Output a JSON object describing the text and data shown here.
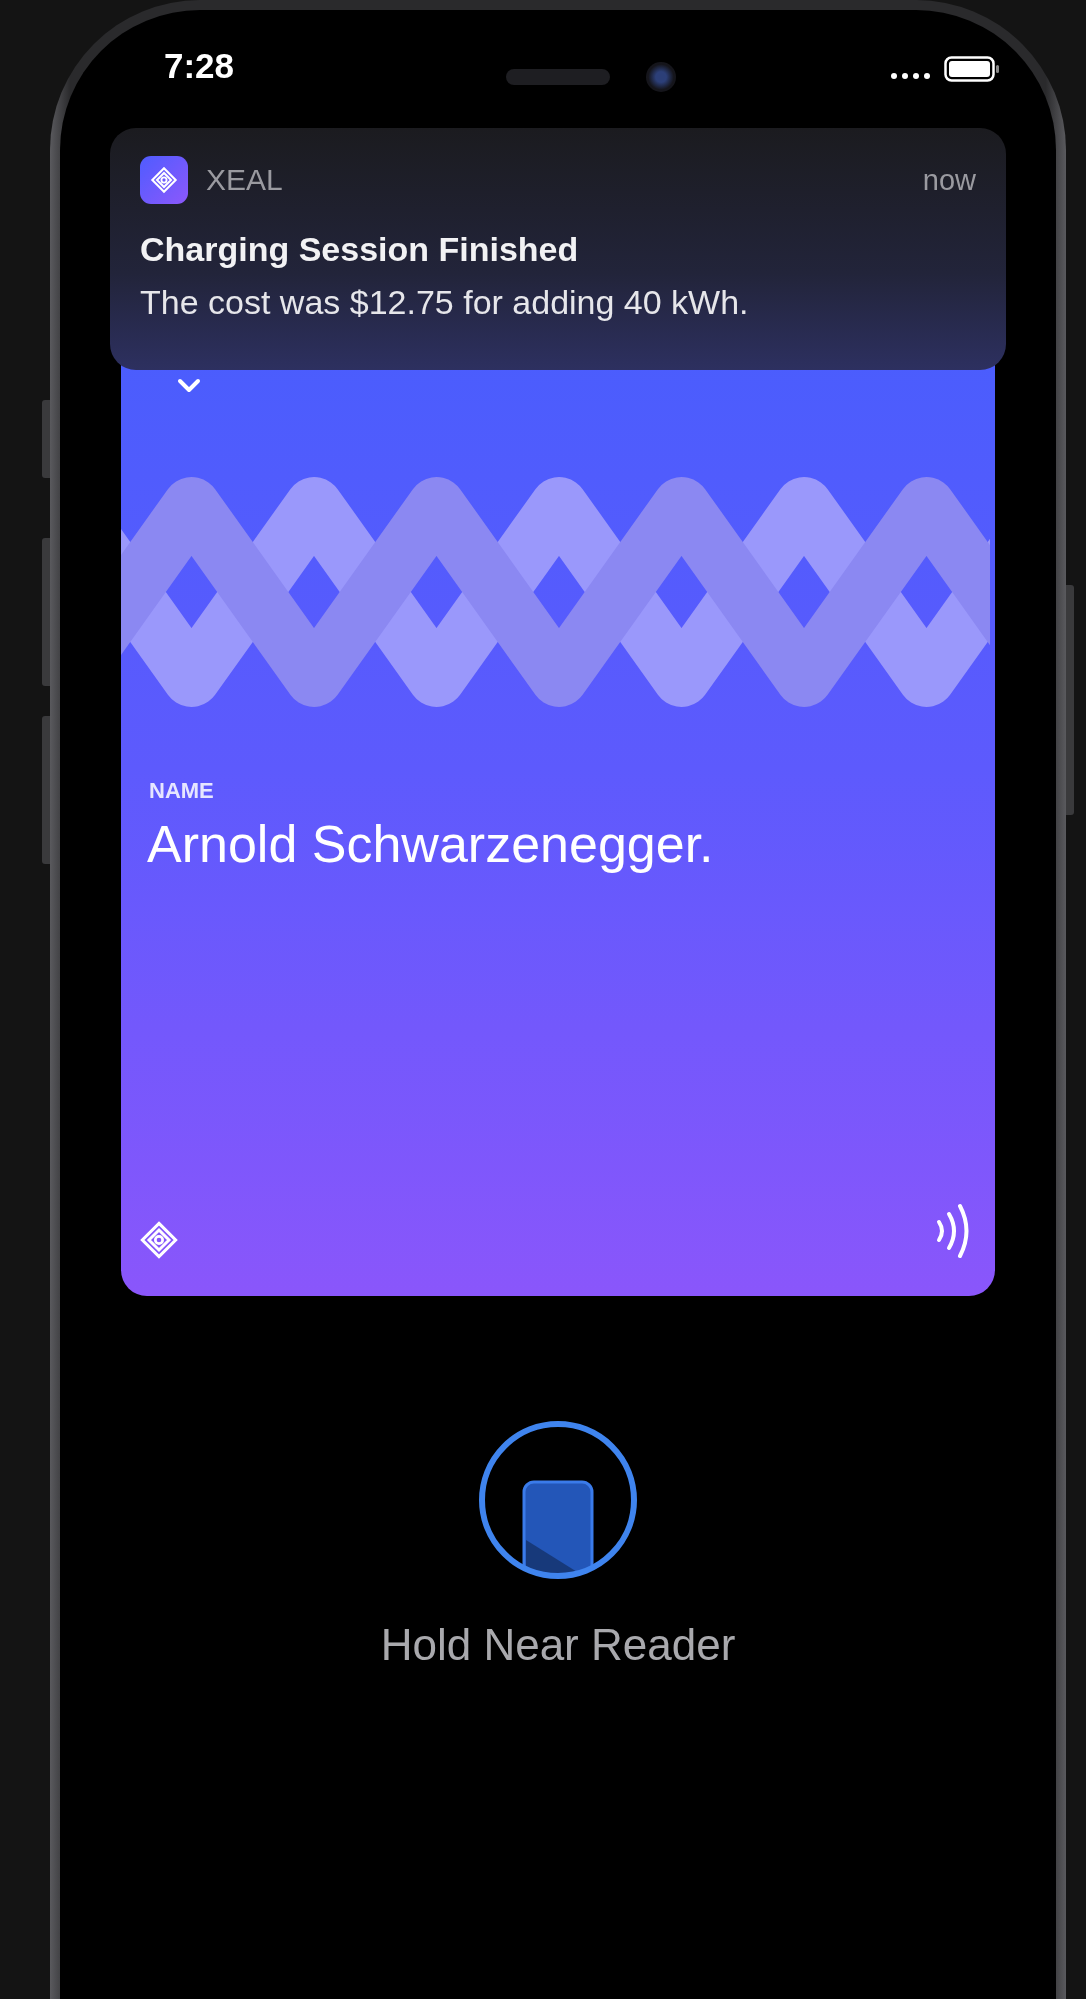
{
  "status_bar": {
    "time": "7:28"
  },
  "notification": {
    "app_name": "XEAL",
    "time": "now",
    "title": "Charging Session Finished",
    "body": "The cost was $12.75 for adding 40 kWh."
  },
  "pass_card": {
    "label": "NAME",
    "value": "Arnold Schwarzenegger."
  },
  "reader_prompt": {
    "text": "Hold Near Reader"
  }
}
